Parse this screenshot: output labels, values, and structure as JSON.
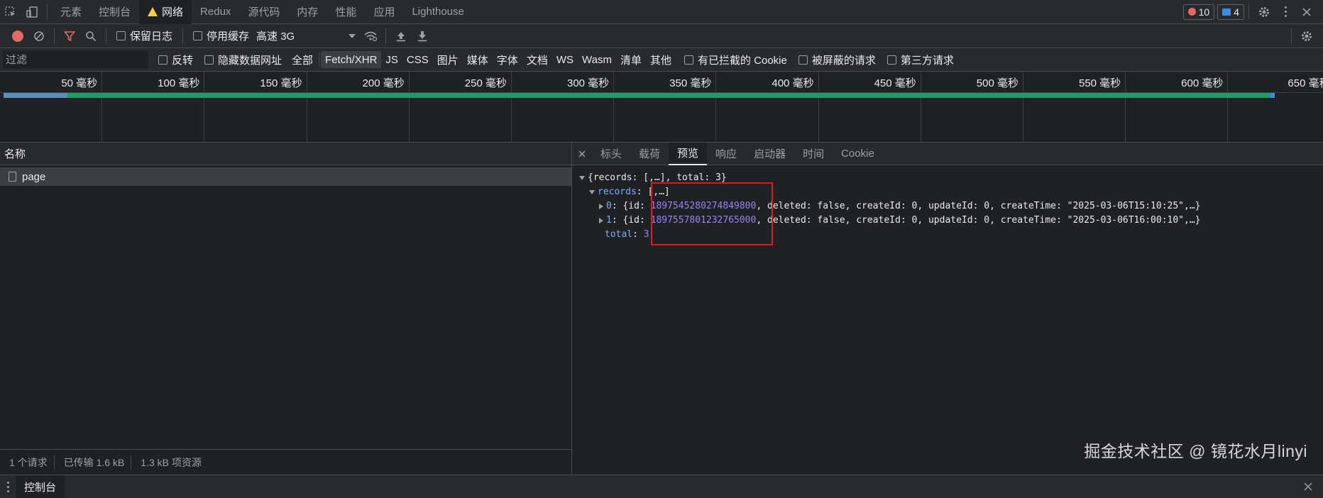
{
  "tabs": [
    "元素",
    "控制台",
    "网络",
    "Redux",
    "源代码",
    "内存",
    "性能",
    "应用",
    "Lighthouse"
  ],
  "active_tab": "网络",
  "badges": {
    "errors": "10",
    "messages": "4"
  },
  "toolbar": {
    "preserve_log": "保留日志",
    "disable_cache": "停用缓存",
    "throttle": "高速 3G"
  },
  "filter": {
    "placeholder": "过滤",
    "invert": "反转",
    "hide_data_urls": "隐藏数据网址",
    "types": [
      "全部",
      "Fetch/XHR",
      "JS",
      "CSS",
      "图片",
      "媒体",
      "字体",
      "文档",
      "WS",
      "Wasm",
      "清单",
      "其他"
    ],
    "active_type": "Fetch/XHR",
    "blocked_cookies": "有已拦截的 Cookie",
    "blocked_requests": "被屏蔽的请求",
    "third_party": "第三方请求"
  },
  "timeline": {
    "ticks": [
      "50 毫秒",
      "100 毫秒",
      "150 毫秒",
      "200 毫秒",
      "250 毫秒",
      "300 毫秒",
      "350 毫秒",
      "400 毫秒",
      "450 毫秒",
      "500 毫秒",
      "550 毫秒",
      "600 毫秒",
      "650 毫秒"
    ]
  },
  "requests": {
    "column_name": "名称",
    "rows": [
      {
        "name": "page"
      }
    ]
  },
  "status": {
    "count": "1 个请求",
    "transferred": "已传输 1.6 kB",
    "resources": "1.3 kB 项资源"
  },
  "detail_tabs": [
    "标头",
    "载荷",
    "预览",
    "响应",
    "启动器",
    "时间",
    "Cookie"
  ],
  "active_detail_tab": "预览",
  "preview": {
    "root": "{records: [,…], total: 3}",
    "records_key": "records",
    "records_val": "[,…]",
    "item0_idx": "0",
    "item0_id": "1897545280274849800",
    "item0_rest": ", deleted: false, createId: 0, updateId: 0, createTime: \"2025-03-06T15:10:25\",…}",
    "item1_idx": "1",
    "item1_id": "1897557801232765000",
    "item1_rest": ", deleted: false, createId: 0, updateId: 0, createTime: \"2025-03-06T16:00:10\",…}",
    "total_key": "total",
    "total_val": "3",
    "id_prefix": ": {id: "
  },
  "watermark": "掘金技术社区 @ 镜花水月linyi",
  "drawer": {
    "tab": "控制台"
  },
  "colors": {
    "highlight_box": "#e0191b",
    "record_red": "#e46962",
    "bar_green": "#1b9e66"
  }
}
